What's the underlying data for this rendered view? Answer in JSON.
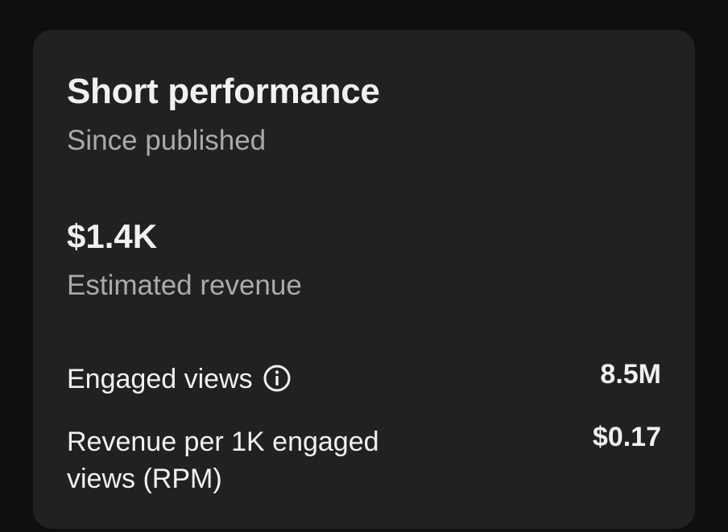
{
  "card": {
    "title": "Short performance",
    "subtitle": "Since published",
    "revenue": {
      "value": "$1.4K",
      "label": "Estimated revenue"
    },
    "metrics": [
      {
        "label": "Engaged views",
        "value": "8.5M",
        "icon": "info-icon"
      },
      {
        "label": "Revenue per 1K engaged views (RPM)",
        "value": "$0.17"
      }
    ]
  },
  "colors": {
    "background": "#0f0f0f",
    "card": "#212121",
    "primary_text": "#f1f1f1",
    "secondary_text": "#aaaaaa"
  }
}
